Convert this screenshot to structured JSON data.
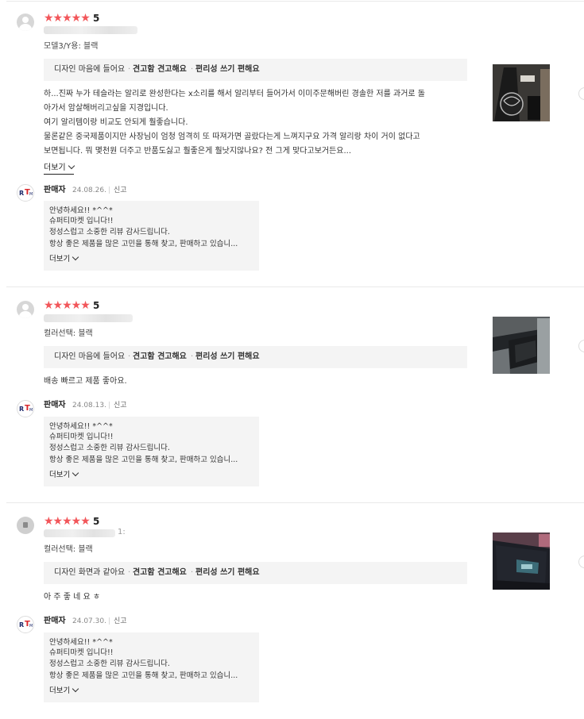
{
  "reviews": [
    {
      "score": "5",
      "stars": "★★★★★",
      "option": "모델3/Y용: 블랙",
      "tags": {
        "design": "디자인 마음에 들어요",
        "build": "견고함 견고해요",
        "conv": "편리성 쓰기 편해요"
      },
      "body_lines": [
        "하...진짜 누가 테슬라는 알리로 완성한다는 x소리를 해서 알리부터 들어가서 이미주문해버린 경솔한 저를 과거로 돌",
        "아가서 암살해버리고싶을 지경입니다.",
        "여기 알리템이랑 비교도 안되게 훨좋습니다.",
        "물론같은 중국제품이지만 사장님이 엄청 엄격히 또 따져가면 골랐다는게 느껴지구요 가격 알리랑 차이 거이 없다고",
        "보면됩니다. 뭐 몇천원 더주고 반품도싫고 훨좋은게 훨낫지않나요? 전 그게 맞다고보거든요..."
      ],
      "more": "더보기",
      "seller": {
        "name": "판매자",
        "date": "24.08.26.",
        "report": "신고",
        "lines": [
          "안녕하세요!! *^^*",
          "슈퍼티마켓 입니다!!",
          "정성스럽고 소중한 리뷰 감사드립니다.",
          "항상 좋은 제품을 많은 고민을 통해 찾고, 판매하고 있습니..."
        ],
        "more": "더보기"
      }
    },
    {
      "score": "5",
      "stars": "★★★★★",
      "option": "컬러선택: 블랙",
      "tags": {
        "design": "디자인 마음에 들어요",
        "build": "견고함 견고해요",
        "conv": "편리성 쓰기 편해요"
      },
      "body_lines": [
        "배송 빠르고 제품 좋아요."
      ],
      "seller": {
        "name": "판매자",
        "date": "24.08.13.",
        "report": "신고",
        "lines": [
          "안녕하세요!! *^^*",
          "슈퍼티마켓 입니다!!",
          "정성스럽고 소중한 리뷰 감사드립니다.",
          "항상 좋은 제품을 많은 고민을 통해 찾고, 판매하고 있습니..."
        ],
        "more": "더보기"
      }
    },
    {
      "score": "5",
      "stars": "★★★★★",
      "date_fragment": "1:",
      "option": "컬러선택: 블랙",
      "tags": {
        "design": "디자인 화면과 같아요",
        "build": "견고함 견고해요",
        "conv": "편리성 쓰기 편해요"
      },
      "body_lines": [
        "아 주 좋 네 요 ㅎ"
      ],
      "seller": {
        "name": "판매자",
        "date": "24.07.30.",
        "report": "신고",
        "lines": [
          "안녕하세요!! *^^*",
          "슈퍼티마켓 입니다!!",
          "정성스럽고 소중한 리뷰 감사드립니다.",
          "항상 좋은 제품을 많은 고민을 통해 찾고, 판매하고 있습니..."
        ],
        "more": "더보기"
      }
    }
  ],
  "seller_logo": {
    "left": "R",
    "mid": "T",
    "right": "M"
  },
  "colors": {
    "star": "#f2565a",
    "box_bg": "#f4f4f4"
  }
}
